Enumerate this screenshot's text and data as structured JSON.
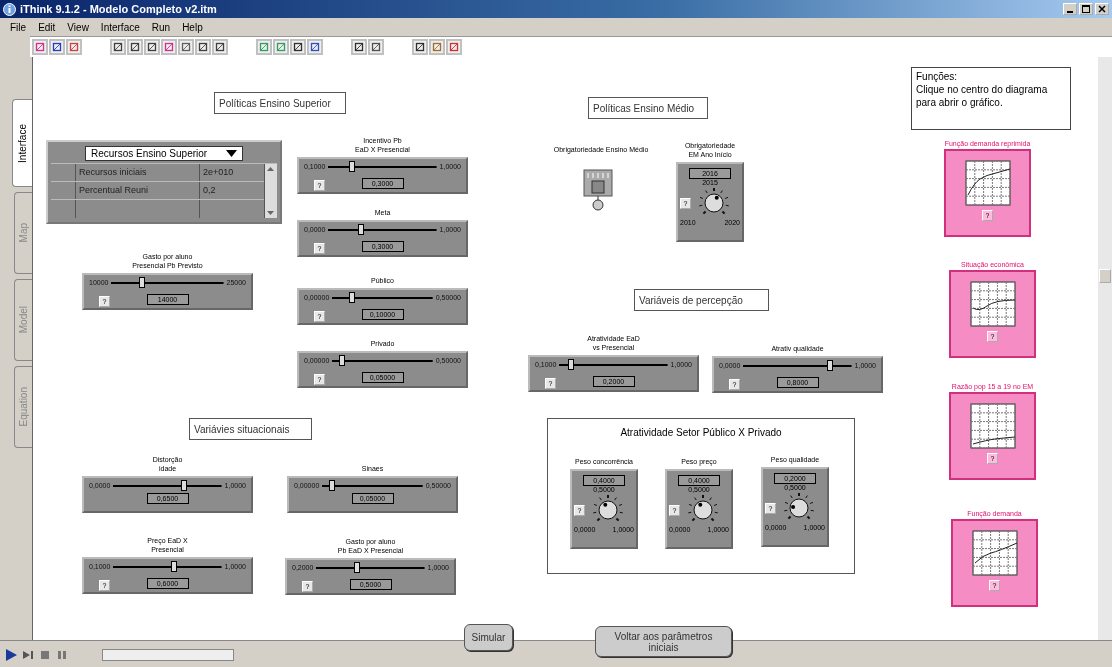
{
  "window": {
    "title": "iThink 9.1.2 - Modelo Completo v2.itm"
  },
  "menu": [
    "File",
    "Edit",
    "View",
    "Interface",
    "Run",
    "Help"
  ],
  "side_tabs": [
    {
      "label": "Interface",
      "selected": true
    },
    {
      "label": "Map",
      "selected": false
    },
    {
      "label": "Model",
      "selected": false
    },
    {
      "label": "Equation",
      "selected": false
    }
  ],
  "canvas": {
    "section_titles": [
      "Políticas Ensino Superior",
      "Políticas Ensino Médio",
      "Variáveis de percepção",
      "Variávies situacionais"
    ],
    "note": "Funções:\nClique no centro do diagrama\npara abrir o gráfico.",
    "table": {
      "dropdown": "Recursos Ensino Superior",
      "rows": [
        [
          "Recursos iniciais",
          "2e+010"
        ],
        [
          "Percentual Reuni",
          "0,2"
        ]
      ]
    },
    "sliders": [
      {
        "label": "Incentivo Pb\nEaD X Presencial",
        "min": "0,1000",
        "max": "1,0000",
        "value": "0,3000",
        "level": 0.22,
        "help": "?"
      },
      {
        "label": "Meta",
        "min": "0,0000",
        "max": "1,0000",
        "value": "0,3000",
        "level": 0.3,
        "help": "?"
      },
      {
        "label": "Gasto por aluno\nPresencial Pb Previsto",
        "min": "10000",
        "max": "25000",
        "value": "14000",
        "level": 0.27,
        "help": "?"
      },
      {
        "label": "Público",
        "min": "0,00000",
        "max": "0,50000",
        "value": "0,10000",
        "level": 0.2,
        "help": "?"
      },
      {
        "label": "Privado",
        "min": "0,00000",
        "max": "0,50000",
        "value": "0,05000",
        "level": 0.1,
        "help": "?"
      },
      {
        "label": "Atratividade EaD\nvs Presencial",
        "min": "0,1000",
        "max": "1,0000",
        "value": "0,2000",
        "level": 0.11,
        "help": "?"
      },
      {
        "label": "Atrativ qualidade",
        "min": "0,0000",
        "max": "1,0000",
        "value": "0,8000",
        "level": 0.8,
        "help": "?"
      },
      {
        "label": "Distorção\nidade",
        "min": "0,0000",
        "max": "1,0000",
        "value": "0,6500",
        "level": 0.65
      },
      {
        "label": "Sinaes",
        "min": "0,00000",
        "max": "0,50000",
        "value": "0,05000",
        "level": 0.1
      },
      {
        "label": "Preço EaD X\nPresencial",
        "min": "0,1000",
        "max": "1,0000",
        "value": "0,6000",
        "level": 0.56,
        "help": "?"
      },
      {
        "label": "Gasto por aluno\nPb EaD X Presencial",
        "min": "0,2000",
        "max": "1,0000",
        "value": "0,5000",
        "level": 0.375,
        "help": "?"
      }
    ],
    "switch": {
      "label": "Obrigatoriedade  Ensino Médio",
      "on": false
    },
    "knobs": [
      {
        "label": "Obrigatoriedade\nEM Ano Início",
        "value": "2016",
        "mid": "2015",
        "min": "2010",
        "max": "2020",
        "level": 0.6,
        "help": "?"
      },
      {
        "label": "Peso concorrência",
        "value": "0,4000",
        "mid": "0,5000",
        "min": "0,0000",
        "max": "1,0000",
        "level": 0.4,
        "help": "?"
      },
      {
        "label": "Peso preço",
        "value": "0,4000",
        "mid": "0,5000",
        "min": "0,0000",
        "max": "1,0000",
        "level": 0.4,
        "help": "?"
      },
      {
        "label": "Peso qualidade",
        "value": "0,2000",
        "mid": "0,5000",
        "min": "0,0000",
        "max": "1,0000",
        "level": 0.2,
        "help": "?"
      }
    ],
    "group": {
      "title": "Atratividade Setor Público X Privado"
    },
    "graphs": [
      {
        "title": "Função demanda  reprimida",
        "help": "?"
      },
      {
        "title": "Situação econômica",
        "help": "?"
      },
      {
        "title": "Razão pop 15 a  19 no EM",
        "help": "?"
      },
      {
        "title": "Função demanda",
        "help": "?"
      }
    ],
    "buttons": [
      "Simular",
      "Voltar aos parâmetros iniciais"
    ]
  }
}
